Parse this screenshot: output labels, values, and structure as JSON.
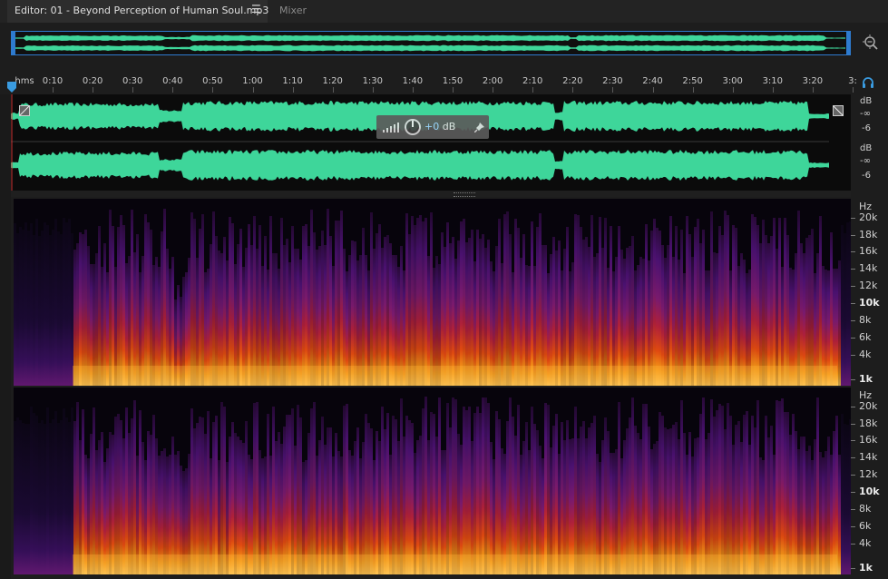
{
  "tabs": {
    "editor_label": "Editor: 01 - Beyond Perception of Human Soul.mp3",
    "editor_menu_icon": "hamburger-menu-icon",
    "mixer_label": "Mixer"
  },
  "ruler": {
    "unit_label": "hms",
    "ticks": [
      "0:10",
      "0:20",
      "0:30",
      "0:40",
      "0:50",
      "1:00",
      "1:10",
      "1:20",
      "1:30",
      "1:40",
      "1:50",
      "2:00",
      "2:10",
      "2:20",
      "2:30",
      "2:40",
      "2:50",
      "3:00",
      "3:10",
      "3:20",
      "3:"
    ]
  },
  "waveform": {
    "db_label": "dB",
    "inf_label": "-∞",
    "minus6_label": "-6"
  },
  "hud": {
    "gain_value": "+0",
    "gain_unit": "dB"
  },
  "spectral": {
    "hz_label": "Hz",
    "freq_labels": [
      "20k",
      "18k",
      "16k",
      "14k",
      "12k",
      "10k",
      "8k",
      "6k",
      "4k",
      "1k"
    ],
    "bold_labels": [
      "10k",
      "1k"
    ]
  },
  "colors": {
    "waveform_green": "#3ed69a",
    "selection_blue": "#2e7bcf",
    "accent_blue": "#3a9be0"
  },
  "icons": {
    "zoom": "zoom-to-time-icon",
    "headphones": "headphones-icon",
    "playhead": "playhead-marker-icon",
    "pin": "pin-icon",
    "knob": "volume-knob-icon",
    "level": "level-meter-icon"
  }
}
